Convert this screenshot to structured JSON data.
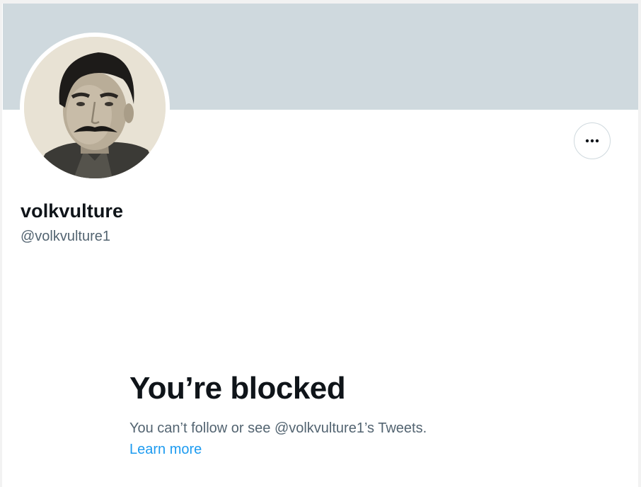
{
  "colors": {
    "banner": "#cfd9de",
    "text_primary": "#0f1419",
    "text_secondary": "#536471",
    "link": "#1d9bf0"
  },
  "profile": {
    "display_name": "volkvulture",
    "handle": "@volkvulture1",
    "avatar_icon": "profile-photo"
  },
  "actions": {
    "more_icon": "more-dots-icon"
  },
  "blocked": {
    "title": "You’re blocked",
    "message": "You can’t follow or see @volkvulture1’s Tweets.",
    "learn_more": "Learn more"
  }
}
